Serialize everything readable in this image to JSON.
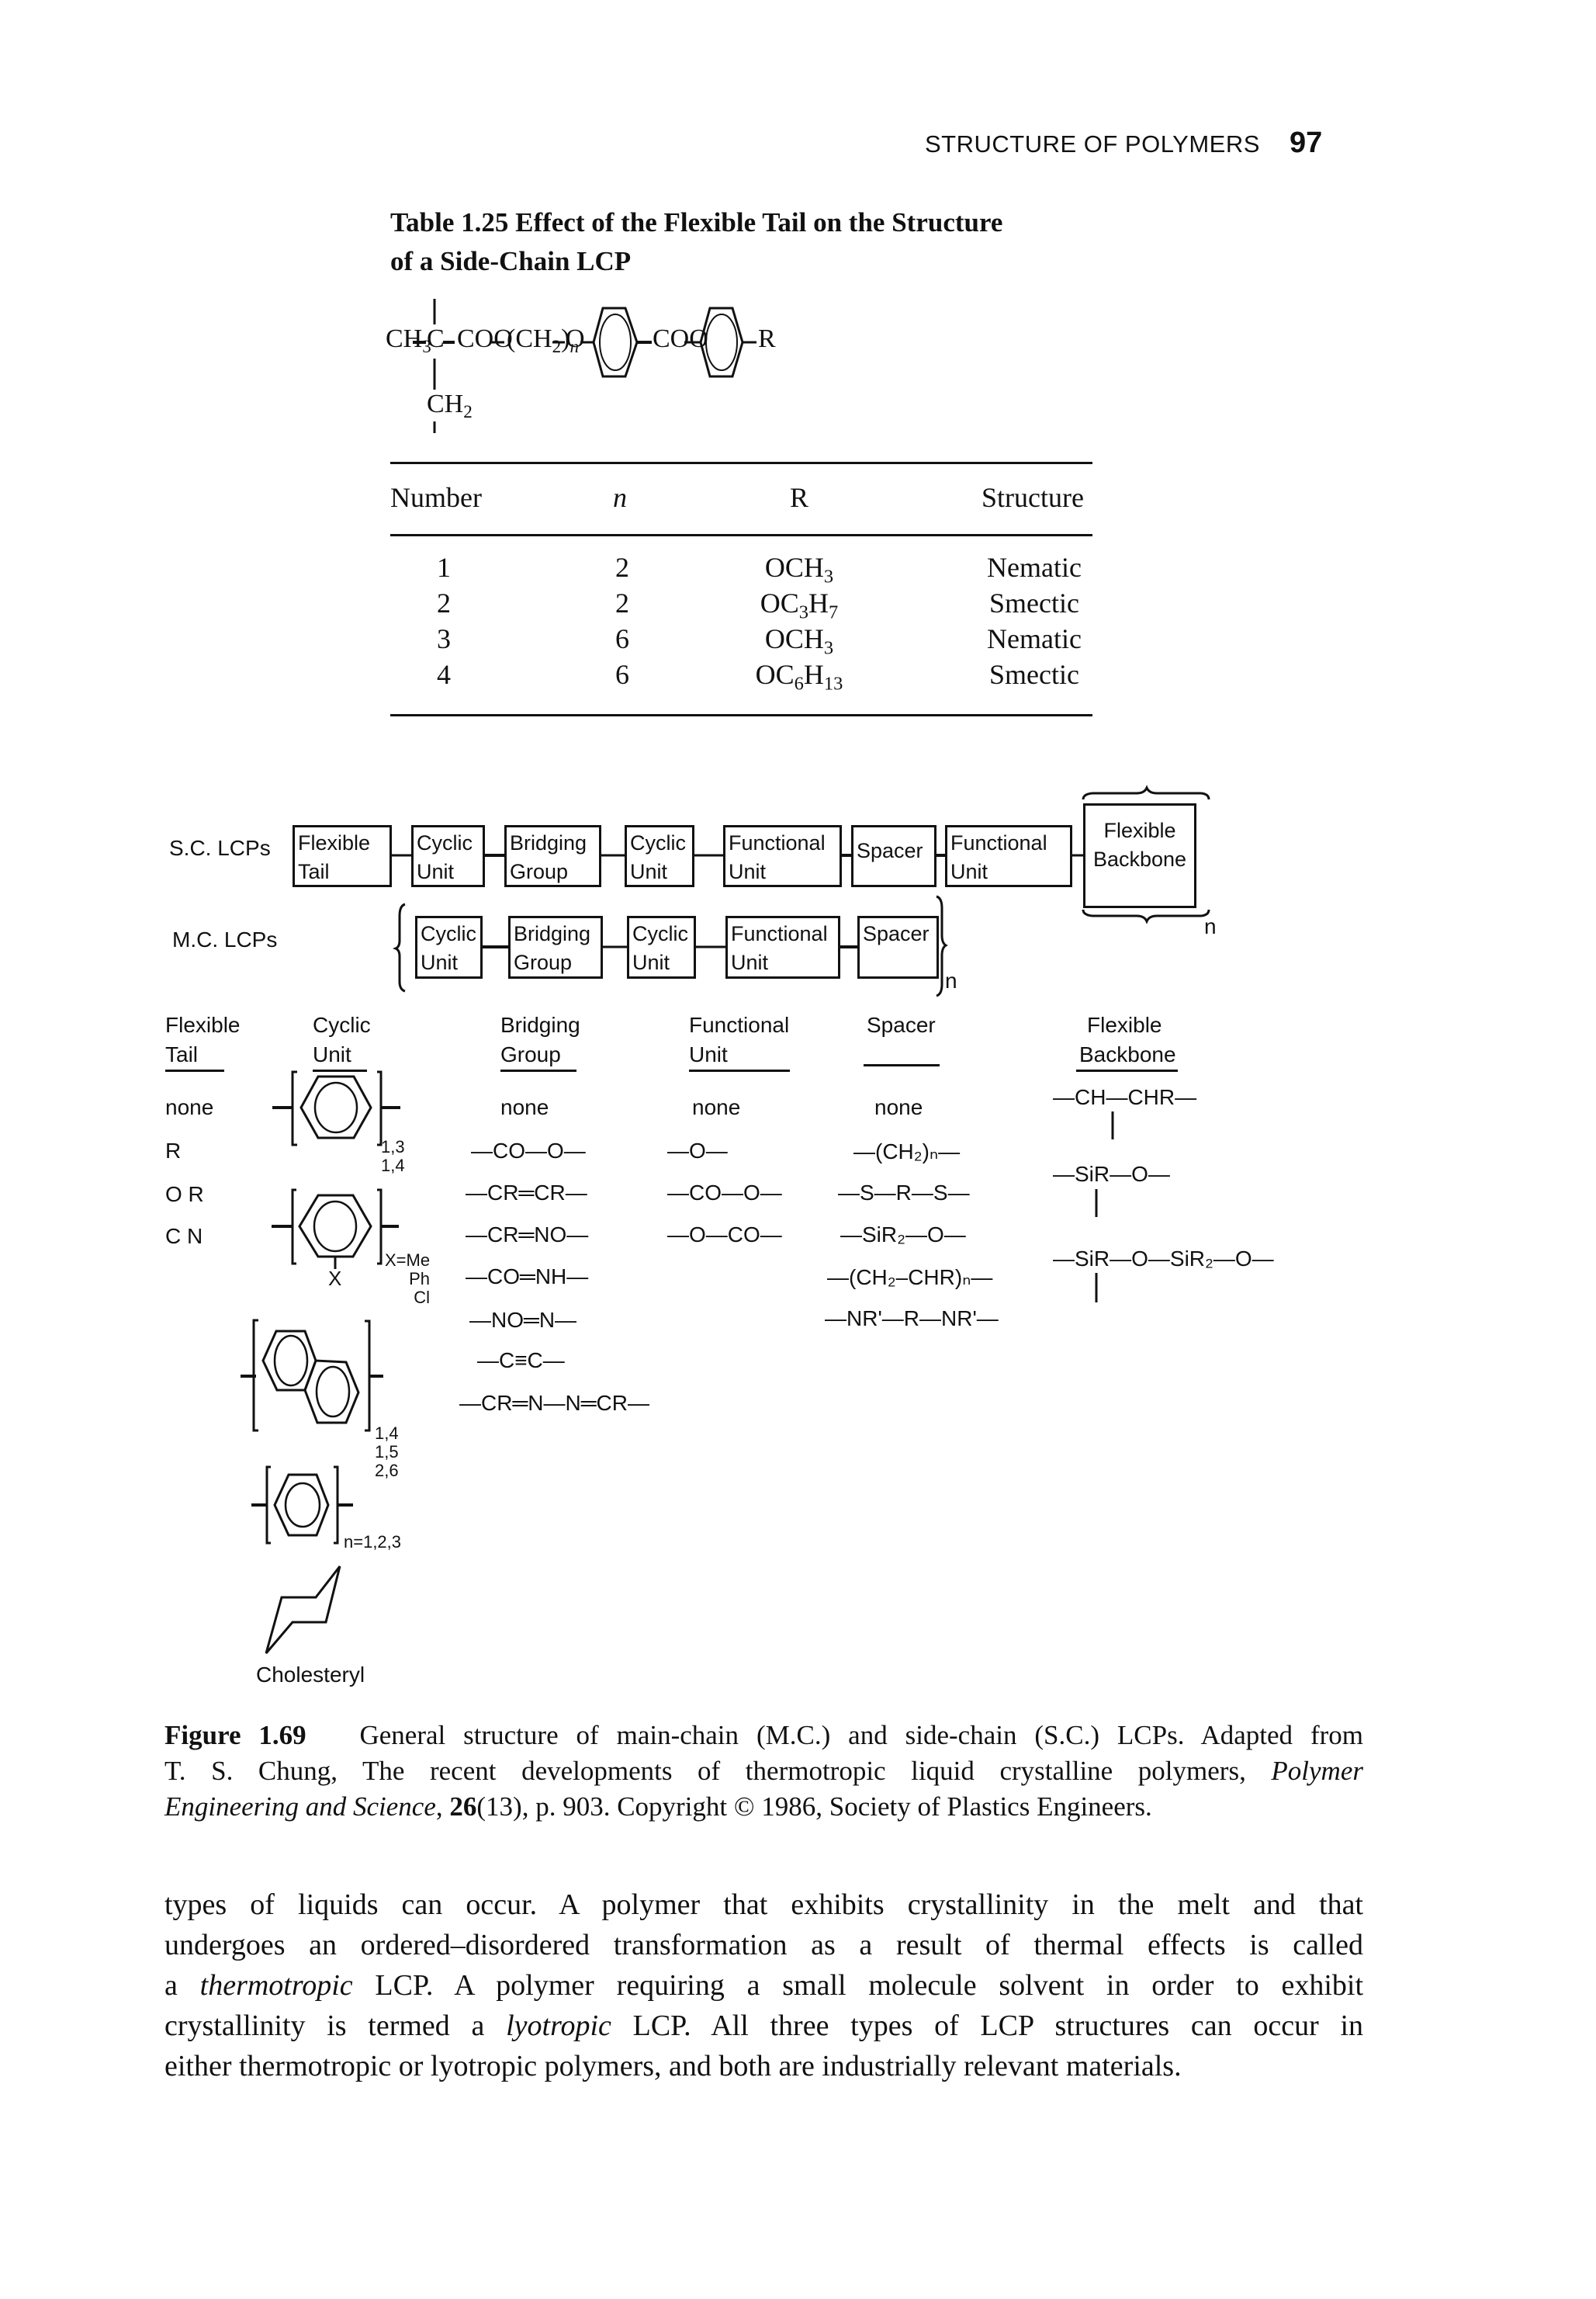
{
  "header": {
    "running_head": "STRUCTURE OF POLYMERS",
    "page_number": "97"
  },
  "table": {
    "title_line1": "Table 1.25   Effect of the Flexible Tail on the Structure",
    "title_line2": "of a Side-Chain LCP",
    "formula": {
      "ch3": "CH",
      "ch3_sub": "3",
      "c": "C",
      "coo1": "COO",
      "ch2n": "(CH",
      "ch2n_sub": "2",
      "ch2n_close": ")",
      "n": "n",
      "o": "O",
      "coo2": "COO",
      "r": "R",
      "ch2": "CH",
      "ch2_sub": "2"
    },
    "columns": [
      "Number",
      "n",
      "R",
      "Structure"
    ],
    "rows": [
      {
        "number": "1",
        "n": "2",
        "r_base": "OCH",
        "r_sub": "3",
        "r_rest": "",
        "r_sub2": "",
        "structure": "Nematic"
      },
      {
        "number": "2",
        "n": "2",
        "r_base": "OC",
        "r_sub": "3",
        "r_rest": "H",
        "r_sub2": "7",
        "structure": "Smectic"
      },
      {
        "number": "3",
        "n": "6",
        "r_base": "OCH",
        "r_sub": "3",
        "r_rest": "",
        "r_sub2": "",
        "structure": "Nematic"
      },
      {
        "number": "4",
        "n": "6",
        "r_base": "OC",
        "r_sub": "6",
        "r_rest": "H",
        "r_sub2": "13",
        "structure": "Smectic"
      }
    ]
  },
  "figure": {
    "sc_label": "S.C. LCPs",
    "mc_label": "M.C. LCPs",
    "sc_boxes": [
      {
        "line1": "Flexible",
        "line2": "Tail"
      },
      {
        "line1": "Cyclic",
        "line2": "Unit"
      },
      {
        "line1": "Bridging",
        "line2": "Group"
      },
      {
        "line1": "Cyclic",
        "line2": "Unit"
      },
      {
        "line1": "Functional",
        "line2": "Unit"
      },
      {
        "line1": "Spacer",
        "line2": ""
      },
      {
        "line1": "Functional",
        "line2": "Unit"
      }
    ],
    "backbone_box": {
      "line1": "Flexible",
      "line2": "Backbone",
      "repeat": "n"
    },
    "mc_boxes": [
      {
        "line1": "Cyclic",
        "line2": "Unit"
      },
      {
        "line1": "Bridging",
        "line2": "Group"
      },
      {
        "line1": "Cyclic",
        "line2": "Unit"
      },
      {
        "line1": "Functional",
        "line2": "Unit"
      },
      {
        "line1": "Spacer",
        "line2": ""
      }
    ],
    "mc_repeat": "n",
    "columns": {
      "flexible_tail": {
        "head1": "Flexible",
        "head2": "Tail",
        "items": [
          "none",
          "R",
          "O R",
          "C N"
        ]
      },
      "cyclic_unit": {
        "head1": "Cyclic",
        "head2": "Unit",
        "benzene_positions": [
          "1,3",
          "1,4"
        ],
        "substituted_x": "X",
        "substituted_values": [
          "X=Me",
          "Ph",
          "Cl"
        ],
        "naphthalene_positions": [
          "1,4",
          "1,5",
          "2,6"
        ],
        "polyphenyl_label": "n=1,2,3",
        "cholesteryl_label": "Cholesteryl"
      },
      "bridging_group": {
        "head1": "Bridging",
        "head2": "Group",
        "items": [
          "none",
          "—CO—O—",
          "—CR═CR—",
          "—CR═NO—",
          "—CO═NH—",
          "—NO═N—",
          "—C≡C—",
          "—CR═N—N═CR—"
        ]
      },
      "functional_unit": {
        "head1": "Functional",
        "head2": "Unit",
        "items": [
          "none",
          "—O—",
          "—CO—O—",
          "—O—CO—"
        ]
      },
      "spacer": {
        "head1": "Spacer",
        "head2": "",
        "items": [
          "none",
          "—(CH₂)ₙ—",
          "—S—R—S—",
          "—SiR₂—O—",
          "—(CH₂–CHR)ₙ—",
          "—NR'—R—NR'—"
        ]
      },
      "flexible_backbone": {
        "head1": "Flexible",
        "head2": "Backbone",
        "items": [
          "—CH—CHR—",
          "—SiR—O—",
          "—SiR—O—SiR₂—O—"
        ]
      }
    },
    "caption": {
      "label": "Figure 1.69",
      "line1_text": "General structure of main-chain (M.C.) and side-chain (S.C.) LCPs. Adapted from",
      "line2_text": "T. S. Chung, The recent developments of thermotropic liquid crystalline polymers,",
      "line2_italic": "Polymer",
      "line3_italic": "Engineering and Science",
      "line3_volume": "26",
      "line3_rest": "(13), p. 903. Copyright © 1986, Society of Plastics Engineers."
    }
  },
  "body_text": {
    "line1": "types of liquids can occur. A polymer that exhibits crystallinity in the melt and that",
    "line2": "undergoes an ordered–disordered transformation as a result of thermal effects is called",
    "line3_pre": "a",
    "line3_italic": "thermotropic",
    "line3_post": "LCP. A polymer requiring a small molecule solvent in order to exhibit",
    "line4_pre": "crystallinity is termed a",
    "line4_italic": "lyotropic",
    "line4_post": "LCP. All three types of LCP structures can occur in",
    "line5": "either thermotropic or lyotropic polymers, and both are industrially relevant materials."
  }
}
